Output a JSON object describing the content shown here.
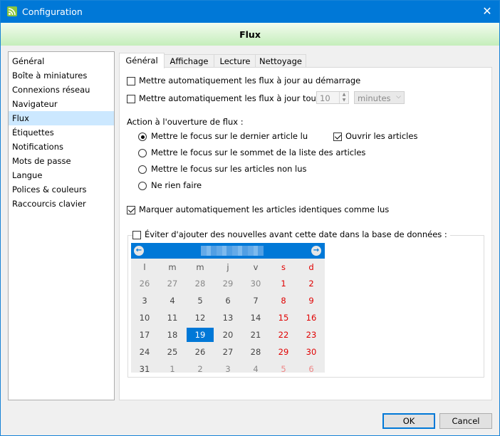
{
  "window": {
    "title": "Configuration",
    "close_glyph": "✕"
  },
  "header": {
    "title": "Flux"
  },
  "categories": [
    "Général",
    "Boîte à miniatures",
    "Connexions réseau",
    "Navigateur",
    "Flux",
    "Étiquettes",
    "Notifications",
    "Mots de passe",
    "Langue",
    "Polices & couleurs",
    "Raccourcis clavier"
  ],
  "selected_category": "Flux",
  "tabs": [
    "Général",
    "Affichage",
    "Lecture",
    "Nettoyage"
  ],
  "active_tab": "Général",
  "options": {
    "update_on_start": {
      "label": "Mettre automatiquement les flux à jour au démarrage",
      "checked": false
    },
    "update_every": {
      "label": "Mettre automatiquement les flux à jour toutes les",
      "checked": false,
      "value": "10",
      "unit": "minutes"
    },
    "action_label": "Action à l'ouverture de flux :",
    "radios": [
      {
        "label": "Mettre le focus sur le dernier article lu",
        "checked": true
      },
      {
        "label": "Mettre le focus sur le sommet de la liste des articles",
        "checked": false
      },
      {
        "label": "Mettre le focus sur les articles non lus",
        "checked": false
      },
      {
        "label": "Ne rien faire",
        "checked": false
      }
    ],
    "open_articles": {
      "label": "Ouvrir les articles",
      "checked": true
    },
    "mark_identical": {
      "label": "Marquer automatiquement les articles identiques comme lus",
      "checked": true
    },
    "avoid_before_date": {
      "label": "Éviter d'ajouter des nouvelles avant cette date dans la base de données :",
      "checked": false
    }
  },
  "calendar": {
    "prev_glyph": "←",
    "next_glyph": "→",
    "weekdays": [
      "l",
      "m",
      "m",
      "j",
      "v",
      "s",
      "d"
    ],
    "weeks": [
      [
        "26",
        "27",
        "28",
        "29",
        "30",
        "1",
        "2"
      ],
      [
        "3",
        "4",
        "5",
        "6",
        "7",
        "8",
        "9"
      ],
      [
        "10",
        "11",
        "12",
        "13",
        "14",
        "15",
        "16"
      ],
      [
        "17",
        "18",
        "19",
        "20",
        "21",
        "22",
        "23"
      ],
      [
        "24",
        "25",
        "26",
        "27",
        "28",
        "29",
        "30"
      ],
      [
        "31",
        "1",
        "2",
        "3",
        "4",
        "5",
        "6"
      ]
    ],
    "selected_day": "19"
  },
  "buttons": {
    "ok": "OK",
    "cancel": "Cancel"
  },
  "colors": {
    "accent": "#0078d7",
    "weekend": "#e00000",
    "header_green": "#c5eebb"
  }
}
